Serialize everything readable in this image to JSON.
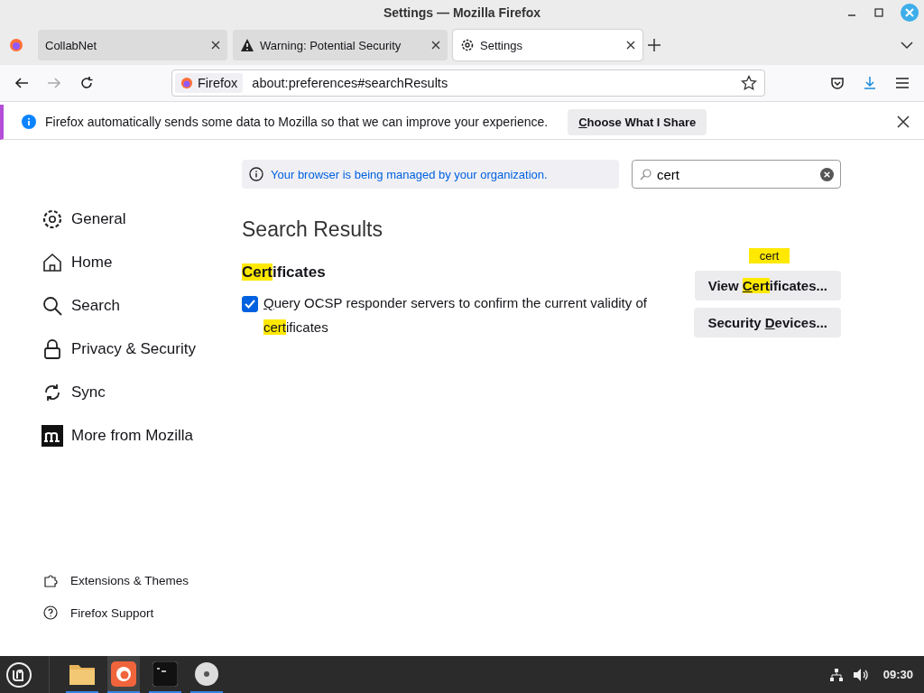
{
  "window": {
    "title": "Settings — Mozilla Firefox"
  },
  "tabs": [
    {
      "label": "CollabNet",
      "kind": "plain",
      "selected": false
    },
    {
      "label": "Warning: Potential Security",
      "kind": "warning",
      "selected": false
    },
    {
      "label": "Settings",
      "kind": "settings",
      "selected": true
    }
  ],
  "address_bar": {
    "identity": "Firefox",
    "url": "about:preferences#searchResults"
  },
  "notification": {
    "message": "Firefox automatically sends some data to Mozilla so that we can improve your experience.",
    "button": [
      {
        "text": "C",
        "underlined": true
      },
      {
        "text": "hoose What I Share",
        "underlined": false
      }
    ]
  },
  "managed_notice": "Your browser is being managed by your organization.",
  "search": {
    "value": "cert"
  },
  "categories": [
    {
      "label": "General",
      "selected": false
    },
    {
      "label": "Home",
      "selected": false
    },
    {
      "label": "Search",
      "selected": false
    },
    {
      "label": "Privacy & Security",
      "selected": false
    },
    {
      "label": "Sync",
      "selected": false
    },
    {
      "label": "More from Mozilla",
      "selected": false
    }
  ],
  "footer_links": [
    {
      "label": "Extensions & Themes"
    },
    {
      "label": "Firefox Support"
    }
  ],
  "results_title": "Search Results",
  "group": {
    "heading": [
      {
        "text": "Cert",
        "highlighted": true,
        "underlined": false
      },
      {
        "text": "ificates",
        "highlighted": false,
        "underlined": false
      }
    ],
    "checkbox": {
      "checked": true,
      "label": [
        {
          "text": "Q",
          "highlighted": false,
          "underlined": true
        },
        {
          "text": "uery OCSP responder servers to confirm the current validity of ",
          "highlighted": false,
          "underlined": false
        },
        {
          "text": "cert",
          "highlighted": true,
          "underlined": false
        },
        {
          "text": "ificates",
          "highlighted": false,
          "underlined": false
        }
      ]
    },
    "buttons": [
      {
        "tooltip": "cert",
        "label": [
          {
            "text": "View ",
            "highlighted": false,
            "underlined": false
          },
          {
            "text": "C",
            "highlighted": true,
            "underlined": true
          },
          {
            "text": "ert",
            "highlighted": true,
            "underlined": false
          },
          {
            "text": "ificates...",
            "highlighted": false,
            "underlined": false
          }
        ]
      },
      {
        "label": [
          {
            "text": "Security ",
            "highlighted": false,
            "underlined": false
          },
          {
            "text": "D",
            "highlighted": false,
            "underlined": true
          },
          {
            "text": "evices...",
            "highlighted": false,
            "underlined": false
          }
        ]
      }
    ]
  },
  "taskbar": {
    "apps": [
      {
        "kind": "folder",
        "active": false
      },
      {
        "kind": "firefox",
        "active": true
      },
      {
        "kind": "terminal",
        "active": false
      },
      {
        "kind": "disc",
        "active": false
      }
    ],
    "clock": "09:30"
  }
}
